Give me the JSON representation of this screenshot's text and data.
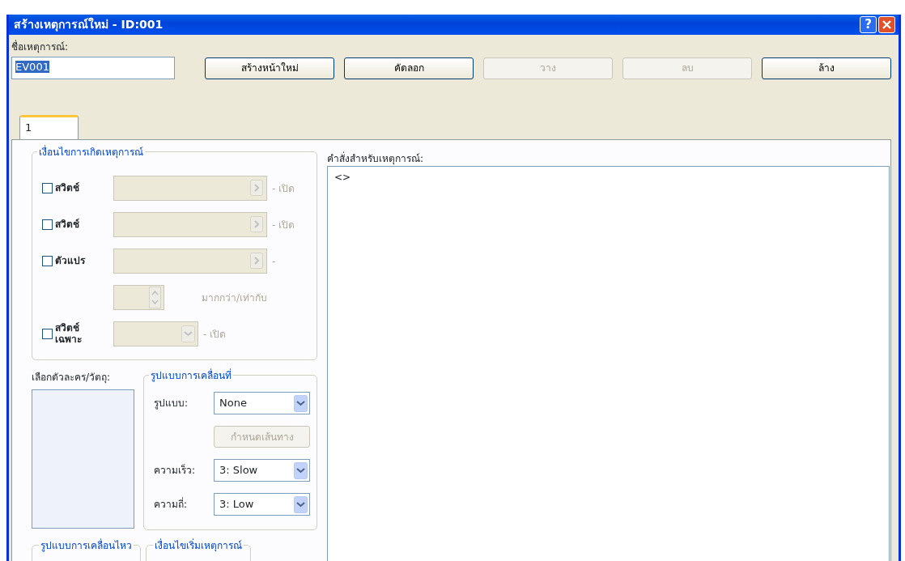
{
  "window": {
    "title": "สร้างเหตุการณ์ใหม่ - ID:001",
    "help": "?"
  },
  "event_name": {
    "label": "ชื่อเหตุการณ์:",
    "value": "EV001",
    "selected": true
  },
  "buttons": [
    {
      "label": "สร้างหน้าใหม่",
      "disabled": false
    },
    {
      "label": "คัดลอก",
      "disabled": false
    },
    {
      "label": "วาง",
      "disabled": true
    },
    {
      "label": "ลบ",
      "disabled": true
    },
    {
      "label": "ล้าง",
      "disabled": false
    }
  ],
  "tabs": [
    {
      "label": "1",
      "selected": true
    }
  ],
  "conditions": {
    "title": "เงื่อนไขการเกิดเหตุการณ์",
    "rows": [
      {
        "kind": "picker",
        "label": "สวิตช์",
        "checked": false,
        "suffix": "- เปิด"
      },
      {
        "kind": "picker",
        "label": "สวิตช์",
        "checked": false,
        "suffix": "- เปิด"
      },
      {
        "kind": "picker",
        "label": "ตัวแปร",
        "checked": false,
        "suffix": "-"
      },
      {
        "kind": "spinner",
        "suffix": "มากกว่า/เท่ากับ"
      },
      {
        "kind": "dropdown",
        "label": "สวิตช์ เฉพาะ",
        "checked": false,
        "suffix": "- เปิด"
      }
    ]
  },
  "character_select": {
    "label": "เลือกตัวละคร/วัตถุ:"
  },
  "movement": {
    "title": "รูปแบบการเคลื่อนที่",
    "rows": [
      {
        "kind": "select",
        "label": "รูปแบบ:",
        "value": "None"
      },
      {
        "kind": "button",
        "label": "กำหนดเส้นทาง",
        "disabled": true
      },
      {
        "kind": "select",
        "label": "ความเร็ว:",
        "value": "3: Slow"
      },
      {
        "kind": "select",
        "label": "ความถี่:",
        "value": "3: Low"
      }
    ]
  },
  "bottom_groups": [
    {
      "title": "รูปแบบการเคลื่อนไหว"
    },
    {
      "title": "เงื่อนไขเริ่มเหตุการณ์"
    }
  ],
  "commands": {
    "label": "คำสั่งสำหรับเหตุการณ์:",
    "value": "<>"
  }
}
